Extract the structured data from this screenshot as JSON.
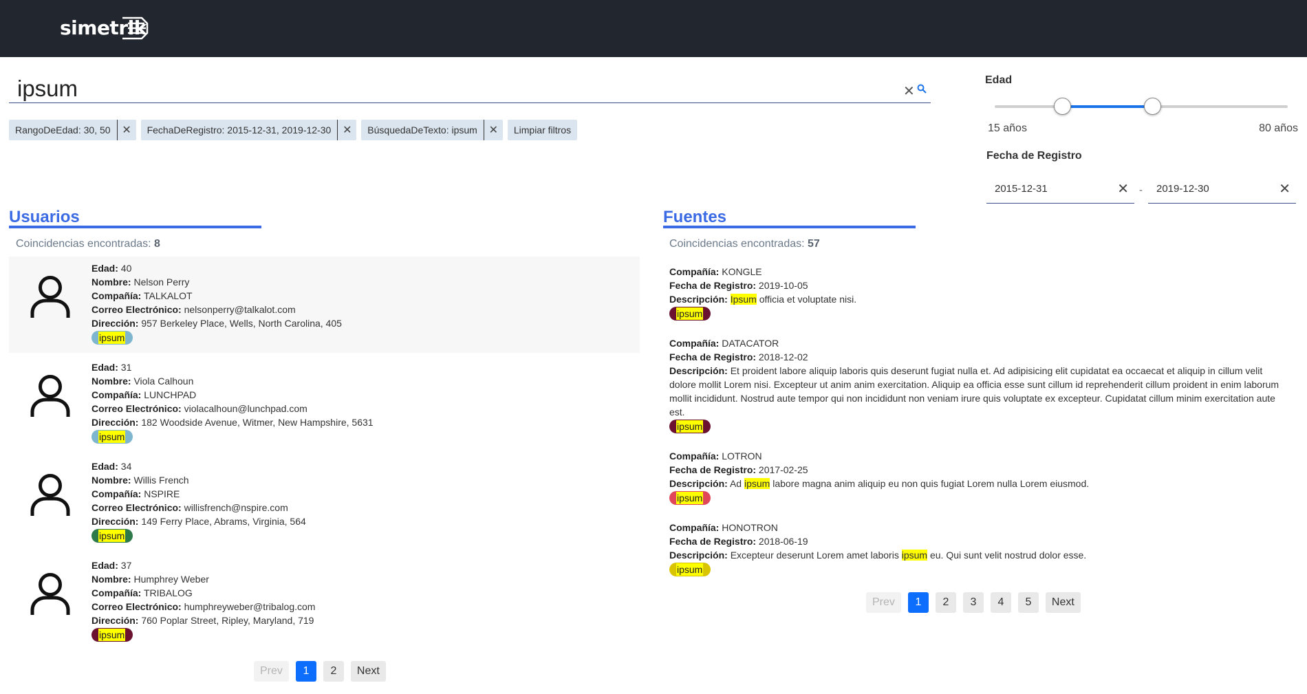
{
  "header": {
    "logo_text": "simetrik"
  },
  "search": {
    "value": "ipsum",
    "placeholder": ""
  },
  "chips": [
    {
      "label": "RangoDeEdad: 30, 50"
    },
    {
      "label": "FechaDeRegistro: 2015-12-31, 2019-12-30"
    },
    {
      "label": "BúsquedaDeTexto: ipsum"
    }
  ],
  "clear_filters_label": "Limpiar filtros",
  "filters": {
    "age_title": "Edad",
    "age_min_label": "15 años",
    "age_max_label": "80 años",
    "age_range": {
      "min": 15,
      "max": 80,
      "low": 30,
      "high": 50
    },
    "date_title": "Fecha de Registro",
    "date_from": "2015-12-31",
    "date_to": "2019-12-30",
    "date_sep": "-"
  },
  "users": {
    "title": "Usuarios",
    "count_label": "Coincidencias encontradas:",
    "count": "8",
    "field_labels": {
      "age": "Edad:",
      "name": "Nombre:",
      "company": "Compañía:",
      "email": "Correo Electrónico:",
      "address": "Dirección:"
    },
    "items": [
      {
        "age": "40",
        "name": "Nelson Perry",
        "company": "TALKALOT",
        "email": "nelsonperry@talkalot.com",
        "address": "957 Berkeley Place, Wells, North Carolina, 405",
        "tag": "ipsum",
        "tag_color": "#7fb6cf"
      },
      {
        "age": "31",
        "name": "Viola Calhoun",
        "company": "LUNCHPAD",
        "email": "violacalhoun@lunchpad.com",
        "address": "182 Woodside Avenue, Witmer, New Hampshire, 5631",
        "tag": "ipsum",
        "tag_color": "#7fb6cf"
      },
      {
        "age": "34",
        "name": "Willis French",
        "company": "NSPIRE",
        "email": "willisfrench@nspire.com",
        "address": "149 Ferry Place, Abrams, Virginia, 564",
        "tag": "ipsum",
        "tag_color": "#2e7a4a"
      },
      {
        "age": "37",
        "name": "Humphrey Weber",
        "company": "TRIBALOG",
        "email": "humphreyweber@tribalog.com",
        "address": "760 Poplar Street, Ripley, Maryland, 719",
        "tag": "ipsum",
        "tag_color": "#6b1230"
      }
    ],
    "pager": [
      "Prev",
      "1",
      "2",
      "Next"
    ]
  },
  "sources": {
    "title": "Fuentes",
    "count_label": "Coincidencias encontradas:",
    "count": "57",
    "field_labels": {
      "company": "Compañía:",
      "date": "Fecha de Registro:",
      "description": "Descripción:"
    },
    "items": [
      {
        "company": "KONGLE",
        "date": "2019-10-05",
        "desc_pre": "",
        "desc_mark": "Ipsum",
        "desc_post": " officia et voluptate nisi.",
        "tag": "ipsum",
        "tag_color": "#6b1230"
      },
      {
        "company": "DATACATOR",
        "date": "2018-12-02",
        "desc_pre": "Et proident labore aliquip laboris quis deserunt fugiat nulla et. Ad adipisicing elit cupidatat ea occaecat et aliquip in cillum velit dolore mollit Lorem nisi. Excepteur ut anim anim exercitation. Aliquip ea officia esse sunt cillum id reprehenderit cillum proident in enim laborum mollit incididunt. Nostrud aute tempor qui non incididunt non veniam irure quis voluptate ex excepteur. Cupidatat cillum minim exercitation aute est.",
        "desc_mark": "",
        "desc_post": "",
        "tag": "ipsum",
        "tag_color": "#6b1230"
      },
      {
        "company": "LOTRON",
        "date": "2017-02-25",
        "desc_pre": "Ad ",
        "desc_mark": "ipsum",
        "desc_post": " labore magna anim aliquip eu non quis fugiat Lorem nulla Lorem eiusmod.",
        "tag": "ipsum",
        "tag_color": "#e0485a"
      },
      {
        "company": "HONOTRON",
        "date": "2018-06-19",
        "desc_pre": "Excepteur deserunt Lorem amet laboris ",
        "desc_mark": "ipsum",
        "desc_post": " eu. Qui sunt velit nostrud dolor esse.",
        "tag": "ipsum",
        "tag_color": "#d8c400"
      }
    ],
    "pager": [
      "Prev",
      "1",
      "2",
      "3",
      "4",
      "5",
      "Next"
    ]
  },
  "colors": {
    "accent": "#3b6be4",
    "active_page": "#0d6efd",
    "topbar": "#22262e",
    "highlight": "#ffff00"
  }
}
